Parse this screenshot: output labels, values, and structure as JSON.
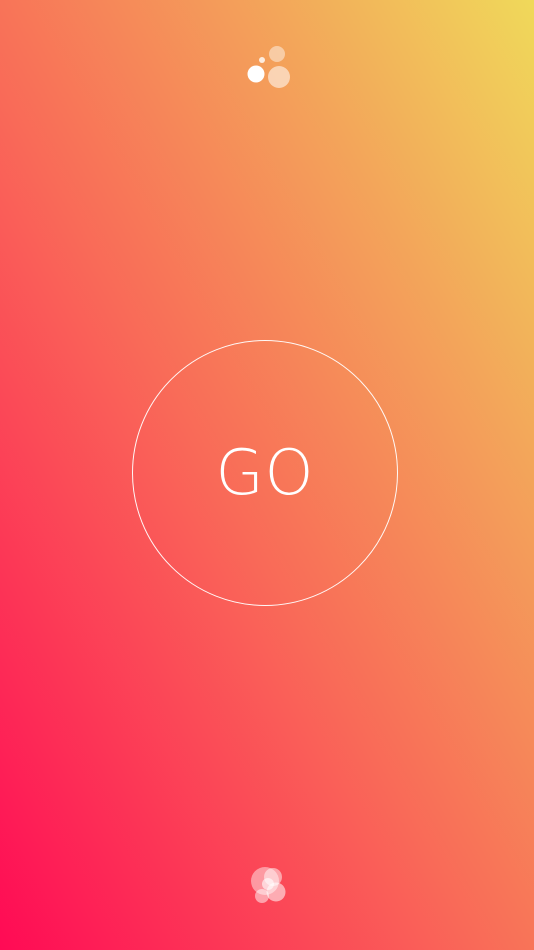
{
  "app": {
    "background_colors": [
      "#ff0a55",
      "#f96a58",
      "#f3a55a",
      "#f0d95a"
    ],
    "top_logo_icon": "bubbles-logo-icon",
    "bottom_icon": "bubbles-cluster-icon"
  },
  "main": {
    "go_button_label": "GO"
  }
}
